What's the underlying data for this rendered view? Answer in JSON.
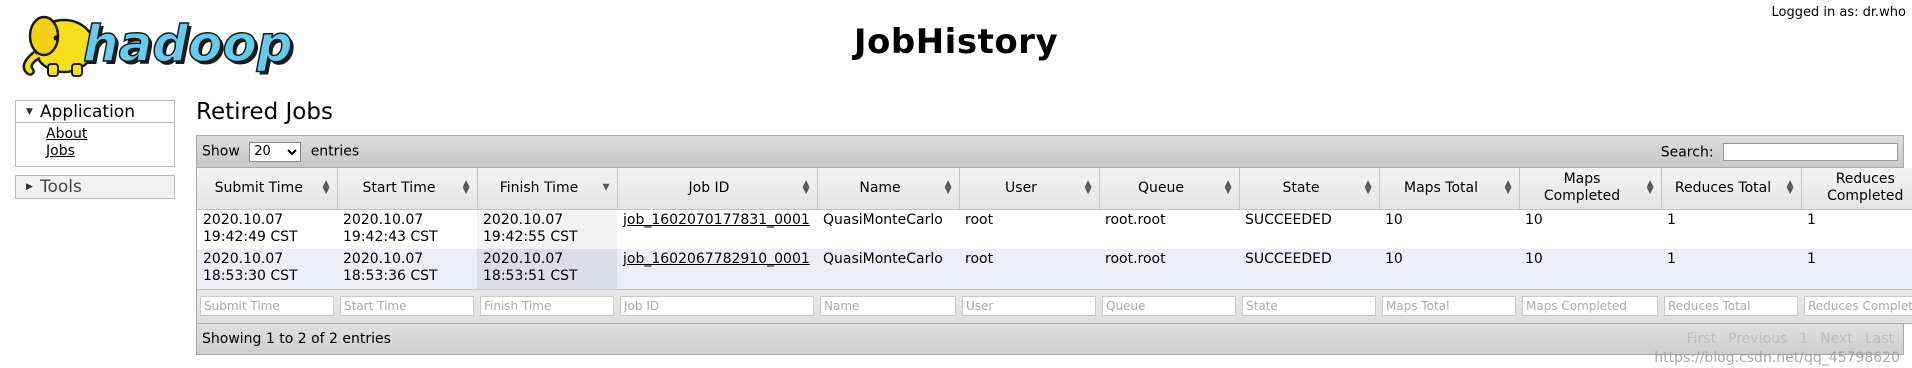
{
  "header": {
    "logo_text": "hadoop",
    "title": "JobHistory",
    "login_info": "Logged in as: dr.who"
  },
  "nav": {
    "application": {
      "label": "Application",
      "items": [
        "About",
        "Jobs"
      ]
    },
    "tools": {
      "label": "Tools"
    }
  },
  "main": {
    "section_title": "Retired Jobs",
    "show_label": "Show",
    "entries_label": "entries",
    "page_size": "20",
    "search_label": "Search:",
    "search_value": ""
  },
  "table": {
    "columns": [
      "Submit Time",
      "Start Time",
      "Finish Time",
      "Job ID",
      "Name",
      "User",
      "Queue",
      "State",
      "Maps Total",
      "Maps Completed",
      "Reduces Total",
      "Reduces Completed"
    ],
    "rows": [
      {
        "submit_date": "2020.10.07",
        "submit_time": "19:42:49 CST",
        "start_date": "2020.10.07",
        "start_time": "19:42:43 CST",
        "finish_date": "2020.10.07",
        "finish_time": "19:42:55 CST",
        "job_id": "job_1602070177831_0001",
        "name": "QuasiMonteCarlo",
        "user": "root",
        "queue": "root.root",
        "state": "SUCCEEDED",
        "maps_total": "10",
        "maps_completed": "10",
        "reduces_total": "1",
        "reduces_completed": "1"
      },
      {
        "submit_date": "2020.10.07",
        "submit_time": "18:53:30 CST",
        "start_date": "2020.10.07",
        "start_time": "18:53:36 CST",
        "finish_date": "2020.10.07",
        "finish_time": "18:53:51 CST",
        "job_id": "job_1602067782910_0001",
        "name": "QuasiMonteCarlo",
        "user": "root",
        "queue": "root.root",
        "state": "SUCCEEDED",
        "maps_total": "10",
        "maps_completed": "10",
        "reduces_total": "1",
        "reduces_completed": "1"
      }
    ],
    "filters": [
      "Submit Time",
      "Start Time",
      "Finish Time",
      "Job ID",
      "Name",
      "User",
      "Queue",
      "State",
      "Maps Total",
      "Maps Completed",
      "Reduces Total",
      "Reduces Completed"
    ]
  },
  "footer": {
    "info": "Showing 1 to 2 of 2 entries",
    "pager": {
      "first": "First",
      "previous": "Previous",
      "current": "1",
      "next": "Next",
      "last": "Last"
    }
  },
  "watermark": "https://blog.csdn.net/qq_45798620",
  "colors": {
    "accent": "#000000",
    "row_alt": "#eeeef8",
    "toolbar": "#cfcfcf"
  }
}
